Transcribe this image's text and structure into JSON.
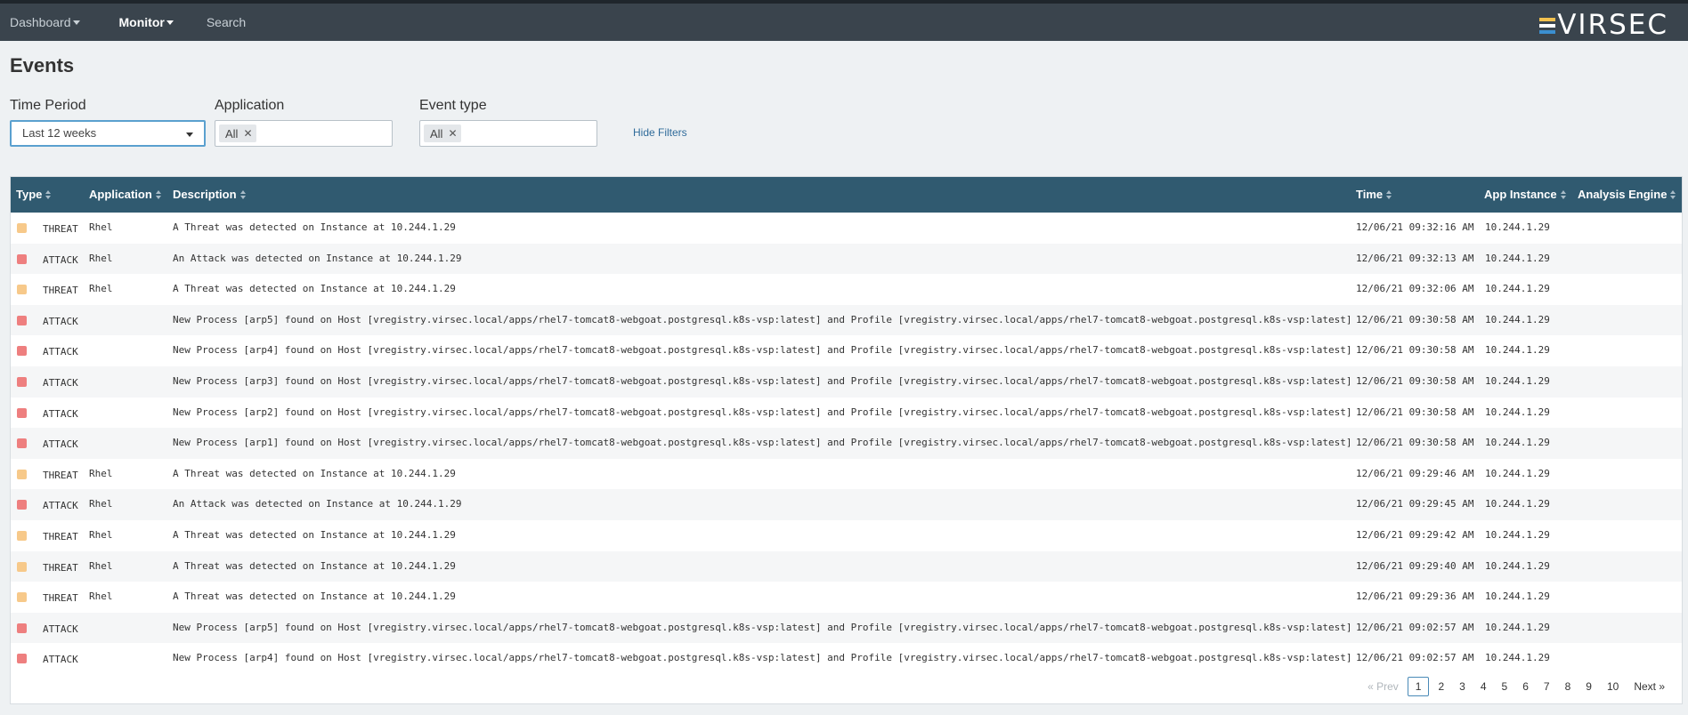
{
  "nav": {
    "dashboard": "Dashboard",
    "monitor": "Monitor",
    "search": "Search"
  },
  "logo": {
    "text": "VIRSEC",
    "bar_colors": [
      "#f2c14e",
      "#ffffff",
      "#3b8fd0"
    ]
  },
  "page": {
    "title": "Events"
  },
  "filters": {
    "time_period": {
      "label": "Time Period",
      "value": "Last 12 weeks"
    },
    "application": {
      "label": "Application",
      "tag": "All"
    },
    "event_type": {
      "label": "Event type",
      "tag": "All"
    },
    "hide_filters": "Hide Filters"
  },
  "colors": {
    "threat": "#f7c98a",
    "attack": "#ee7f7f"
  },
  "table": {
    "columns": {
      "type": "Type",
      "application": "Application",
      "description": "Description",
      "time": "Time",
      "app_instance": "App Instance",
      "analysis_engine": "Analysis Engine"
    },
    "rows": [
      {
        "type": "THREAT",
        "application": "Rhel",
        "description": "A Threat was detected on Instance at 10.244.1.29",
        "time": "12/06/21 09:32:16 AM",
        "app_instance": "10.244.1.29",
        "analysis_engine": ""
      },
      {
        "type": "ATTACK",
        "application": "Rhel",
        "description": "An Attack was detected on Instance at 10.244.1.29",
        "time": "12/06/21 09:32:13 AM",
        "app_instance": "10.244.1.29",
        "analysis_engine": ""
      },
      {
        "type": "THREAT",
        "application": "Rhel",
        "description": "A Threat was detected on Instance at 10.244.1.29",
        "time": "12/06/21 09:32:06 AM",
        "app_instance": "10.244.1.29",
        "analysis_engine": ""
      },
      {
        "type": "ATTACK",
        "application": "",
        "description": "New Process [arp5] found on Host [vregistry.virsec.local/apps/rhel7-tomcat8-webgoat.postgresql.k8s-vsp:latest] and Profile [vregistry.virsec.local/apps/rhel7-tomcat8-webgoat.postgresql.k8s-vsp:latest]",
        "time": "12/06/21 09:30:58 AM",
        "app_instance": "10.244.1.29",
        "analysis_engine": ""
      },
      {
        "type": "ATTACK",
        "application": "",
        "description": "New Process [arp4] found on Host [vregistry.virsec.local/apps/rhel7-tomcat8-webgoat.postgresql.k8s-vsp:latest] and Profile [vregistry.virsec.local/apps/rhel7-tomcat8-webgoat.postgresql.k8s-vsp:latest]",
        "time": "12/06/21 09:30:58 AM",
        "app_instance": "10.244.1.29",
        "analysis_engine": ""
      },
      {
        "type": "ATTACK",
        "application": "",
        "description": "New Process [arp3] found on Host [vregistry.virsec.local/apps/rhel7-tomcat8-webgoat.postgresql.k8s-vsp:latest] and Profile [vregistry.virsec.local/apps/rhel7-tomcat8-webgoat.postgresql.k8s-vsp:latest]",
        "time": "12/06/21 09:30:58 AM",
        "app_instance": "10.244.1.29",
        "analysis_engine": ""
      },
      {
        "type": "ATTACK",
        "application": "",
        "description": "New Process [arp2] found on Host [vregistry.virsec.local/apps/rhel7-tomcat8-webgoat.postgresql.k8s-vsp:latest] and Profile [vregistry.virsec.local/apps/rhel7-tomcat8-webgoat.postgresql.k8s-vsp:latest]",
        "time": "12/06/21 09:30:58 AM",
        "app_instance": "10.244.1.29",
        "analysis_engine": ""
      },
      {
        "type": "ATTACK",
        "application": "",
        "description": "New Process [arp1] found on Host [vregistry.virsec.local/apps/rhel7-tomcat8-webgoat.postgresql.k8s-vsp:latest] and Profile [vregistry.virsec.local/apps/rhel7-tomcat8-webgoat.postgresql.k8s-vsp:latest]",
        "time": "12/06/21 09:30:58 AM",
        "app_instance": "10.244.1.29",
        "analysis_engine": ""
      },
      {
        "type": "THREAT",
        "application": "Rhel",
        "description": "A Threat was detected on Instance at 10.244.1.29",
        "time": "12/06/21 09:29:46 AM",
        "app_instance": "10.244.1.29",
        "analysis_engine": ""
      },
      {
        "type": "ATTACK",
        "application": "Rhel",
        "description": "An Attack was detected on Instance at 10.244.1.29",
        "time": "12/06/21 09:29:45 AM",
        "app_instance": "10.244.1.29",
        "analysis_engine": ""
      },
      {
        "type": "THREAT",
        "application": "Rhel",
        "description": "A Threat was detected on Instance at 10.244.1.29",
        "time": "12/06/21 09:29:42 AM",
        "app_instance": "10.244.1.29",
        "analysis_engine": ""
      },
      {
        "type": "THREAT",
        "application": "Rhel",
        "description": "A Threat was detected on Instance at 10.244.1.29",
        "time": "12/06/21 09:29:40 AM",
        "app_instance": "10.244.1.29",
        "analysis_engine": ""
      },
      {
        "type": "THREAT",
        "application": "Rhel",
        "description": "A Threat was detected on Instance at 10.244.1.29",
        "time": "12/06/21 09:29:36 AM",
        "app_instance": "10.244.1.29",
        "analysis_engine": ""
      },
      {
        "type": "ATTACK",
        "application": "",
        "description": "New Process [arp5] found on Host [vregistry.virsec.local/apps/rhel7-tomcat8-webgoat.postgresql.k8s-vsp:latest] and Profile [vregistry.virsec.local/apps/rhel7-tomcat8-webgoat.postgresql.k8s-vsp:latest]",
        "time": "12/06/21 09:02:57 AM",
        "app_instance": "10.244.1.29",
        "analysis_engine": ""
      },
      {
        "type": "ATTACK",
        "application": "",
        "description": "New Process [arp4] found on Host [vregistry.virsec.local/apps/rhel7-tomcat8-webgoat.postgresql.k8s-vsp:latest] and Profile [vregistry.virsec.local/apps/rhel7-tomcat8-webgoat.postgresql.k8s-vsp:latest]",
        "time": "12/06/21 09:02:57 AM",
        "app_instance": "10.244.1.29",
        "analysis_engine": ""
      }
    ]
  },
  "pagination": {
    "prev": "« Prev",
    "next": "Next »",
    "pages": [
      "1",
      "2",
      "3",
      "4",
      "5",
      "6",
      "7",
      "8",
      "9",
      "10"
    ],
    "current": "1"
  }
}
